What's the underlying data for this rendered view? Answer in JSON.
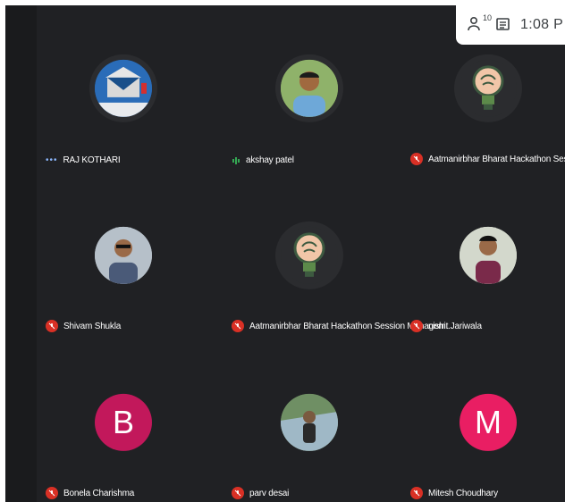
{
  "topbar": {
    "participant_count": "10",
    "time": "1:08 P",
    "icons": [
      "people-icon",
      "chat-icon"
    ]
  },
  "participants": [
    {
      "name": "RAJ KOTHARI",
      "status": "speaking-dots",
      "avatar": "photo-logo"
    },
    {
      "name": "akshay patel",
      "status": "speaking-wave",
      "avatar": "photo-person"
    },
    {
      "name": "Aatmanirbhar Bharat Hackathon Session Man",
      "status": "muted",
      "avatar": "brain-bulb"
    },
    {
      "name": "Shivam Shukla",
      "status": "muted",
      "avatar": "photo-person"
    },
    {
      "name": "Aatmanirbhar Bharat Hackathon Session Managem...",
      "status": "muted",
      "avatar": "brain-bulb"
    },
    {
      "name": "nishit Jariwala",
      "status": "muted",
      "avatar": "photo-person"
    },
    {
      "name": "Bonela Charishma",
      "status": "muted",
      "avatar": "letter",
      "letter": "B",
      "color": "#c2185b"
    },
    {
      "name": "parv desai",
      "status": "muted",
      "avatar": "photo-person"
    },
    {
      "name": "Mitesh Choudhary",
      "status": "muted",
      "avatar": "letter",
      "letter": "M",
      "color": "#e91e63"
    }
  ],
  "colors": {
    "background": "#202124",
    "mic_muted": "#d93025",
    "speaking": "#8ab4f8"
  }
}
